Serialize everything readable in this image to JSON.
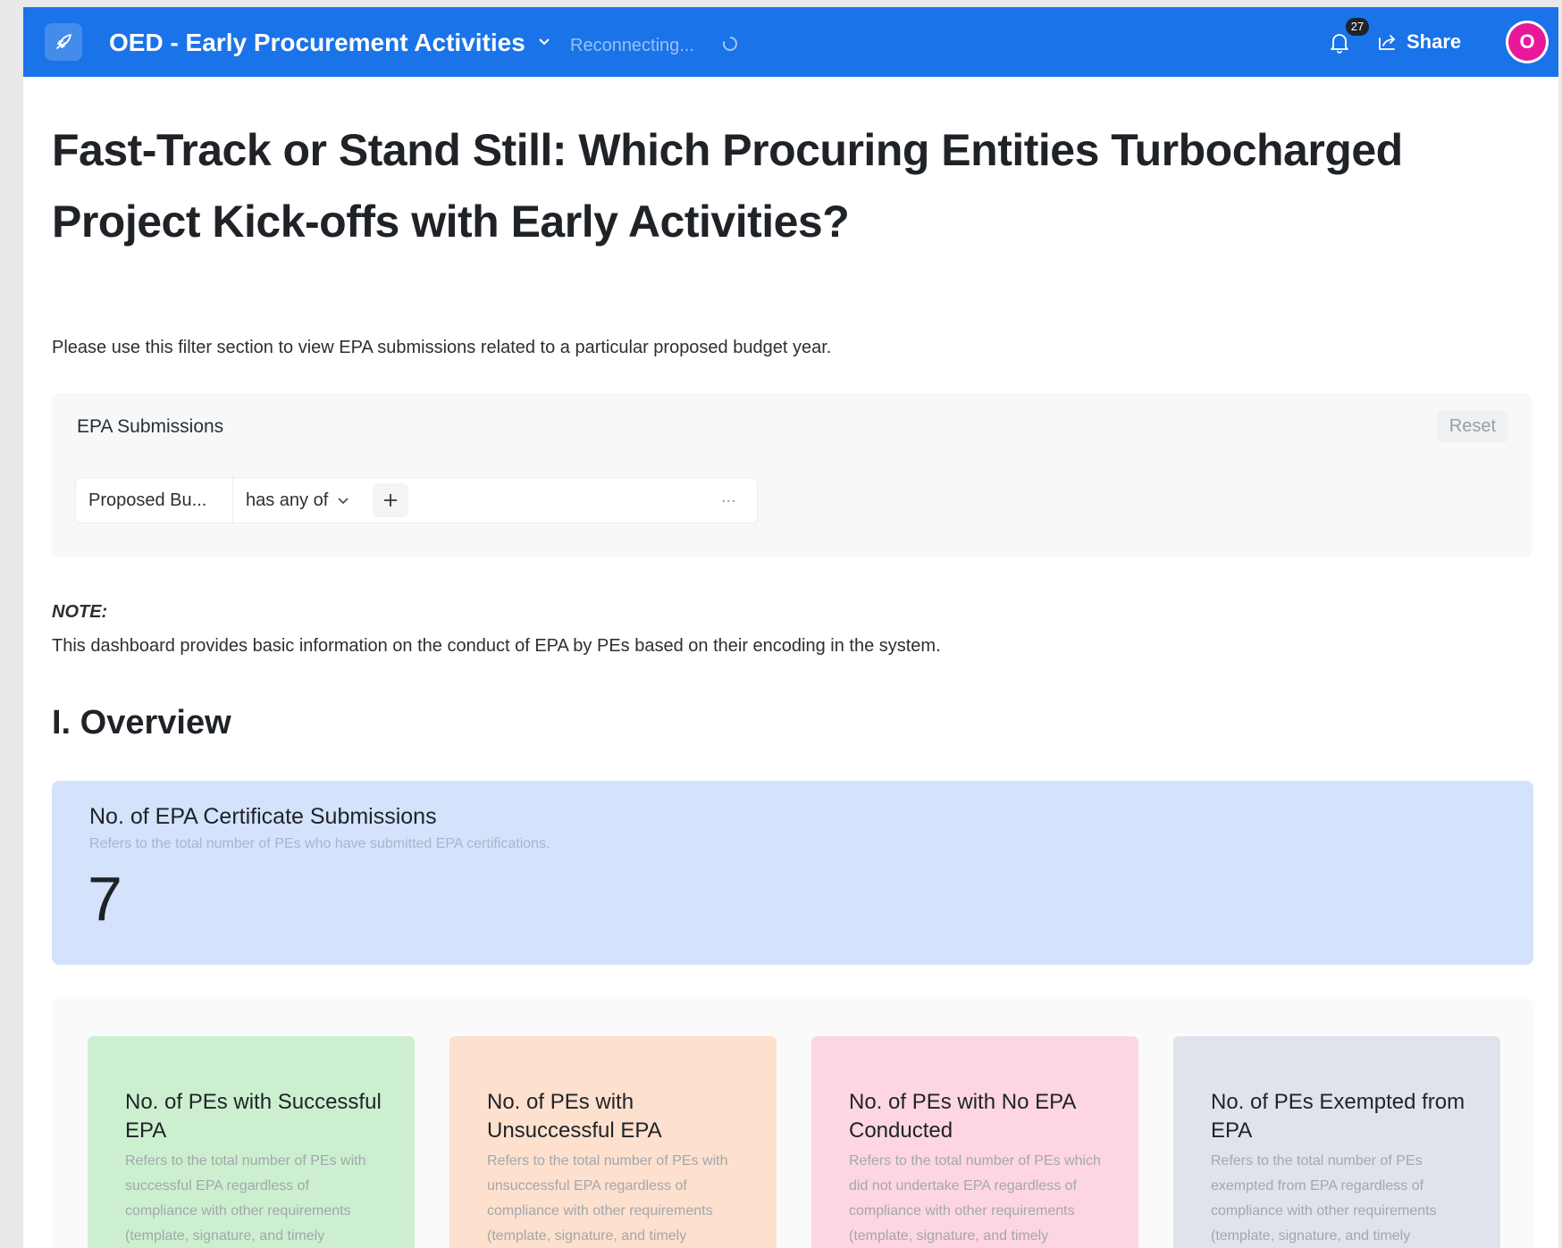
{
  "topbar": {
    "title": "OED - Early Procurement Activities",
    "status": "Reconnecting...",
    "notification_count": "27",
    "share_label": "Share",
    "avatar_initial": "O",
    "bg_color": "#1a73e8",
    "icons": [
      "rocket-icon",
      "chevron-down-icon",
      "spinner-icon",
      "bell-icon",
      "share-icon"
    ]
  },
  "page": {
    "title": "Fast-Track or Stand Still: Which Procuring Entities Turbocharged Project Kick-offs with Early Activities?",
    "intro": "Please use this filter section to view EPA submissions related to a particular proposed budget year."
  },
  "filter": {
    "title": "EPA Submissions",
    "reset_label": "Reset",
    "field": "Proposed Bu...",
    "operator": "has any of",
    "more": "..."
  },
  "note": {
    "label": "NOTE:",
    "text": "This dashboard provides basic information on the conduct of EPA by PEs based on their encoding in the system."
  },
  "overview": {
    "section_title": "I. Overview",
    "kpi": {
      "title": "No. of EPA Certificate Submissions",
      "description": "Refers to the total number of PEs who have submitted EPA certifications.",
      "value": "7",
      "color": "#d4e2fb"
    },
    "cards": [
      {
        "title": "No. of PEs with Successful EPA",
        "description": "Refers to the total number of PEs with successful EPA regardless of compliance with other requirements (template, signature, and timely",
        "color": "#ccf0cf"
      },
      {
        "title": "No. of PEs with Unsuccessful EPA",
        "description": "Refers to the total number of PEs with unsuccessful EPA regardless of compliance with other requirements (template, signature, and timely",
        "color": "#fde0cd"
      },
      {
        "title": "No. of PEs with No EPA Conducted",
        "description": "Refers to the total number of PEs which did not undertake EPA regardless of compliance with other requirements (template, signature, and timely",
        "color": "#fdd6e1"
      },
      {
        "title": "No. of PEs Exempted from EPA",
        "description": "Refers to the total number of PEs exempted from EPA regardless of compliance with other requirements (template, signature, and timely",
        "color": "#e1e3ec"
      }
    ]
  }
}
